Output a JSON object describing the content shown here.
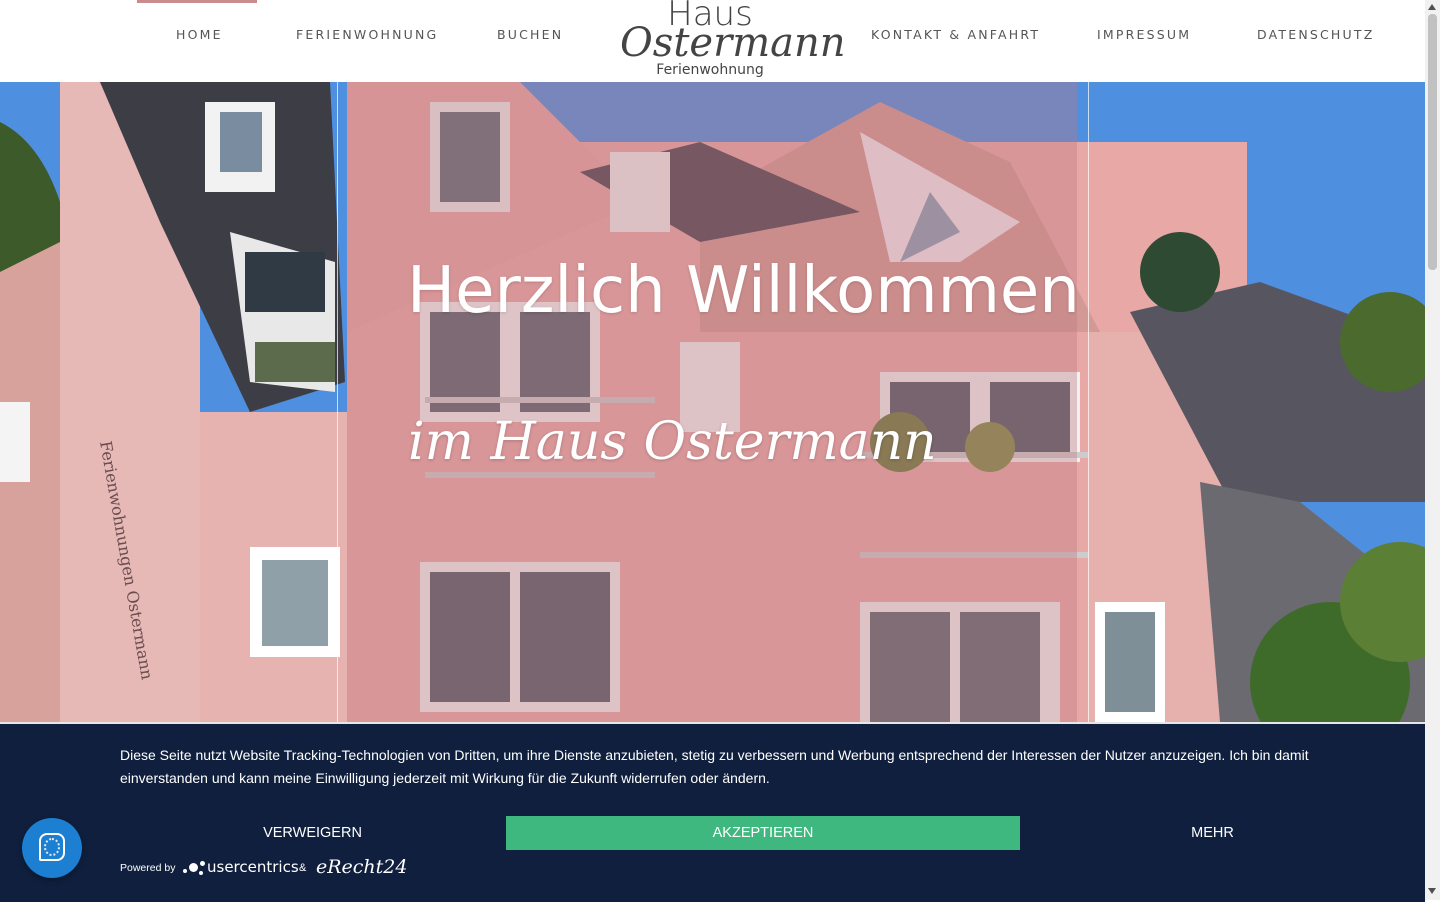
{
  "nav": {
    "items": [
      {
        "label": "HOME",
        "active": true
      },
      {
        "label": "FERIENWOHNUNG"
      },
      {
        "label": "BUCHEN"
      },
      {
        "label": "KONTAKT & ANFAHRT"
      },
      {
        "label": "IMPRESSUM"
      },
      {
        "label": "DATENSCHUTZ"
      }
    ],
    "active_color": "#c98c8c"
  },
  "logo": {
    "top": "Haus",
    "script": "Ostermann",
    "sub": "Ferienwohnung"
  },
  "hero": {
    "title": "Herzlich Willkommen",
    "subtitle": "im Haus Ostermann",
    "sign_text": "Ferienwohnungen Ostermann",
    "overlay_color": "#be7882"
  },
  "cookie": {
    "text": "Diese Seite nutzt Website Tracking-Technologien von Dritten, um ihre Dienste anzubieten, stetig zu verbessern und Werbung entsprechend der Interessen der Nutzer anzuzeigen. Ich bin damit einverstanden und kann meine Einwilligung jederzeit mit Wirkung für die Zukunft widerrufen oder ändern.",
    "deny_label": "VERWEIGERN",
    "accept_label": "AKZEPTIEREN",
    "more_label": "MEHR",
    "powered_by": "Powered by",
    "usercentrics": "usercentrics",
    "amp": "&",
    "erecht": "eRecht24",
    "background": "#0f1f3d",
    "accept_color": "#3fb87f"
  },
  "privacy_button": {
    "icon": "fingerprint-icon",
    "color": "#1d7fd1"
  }
}
